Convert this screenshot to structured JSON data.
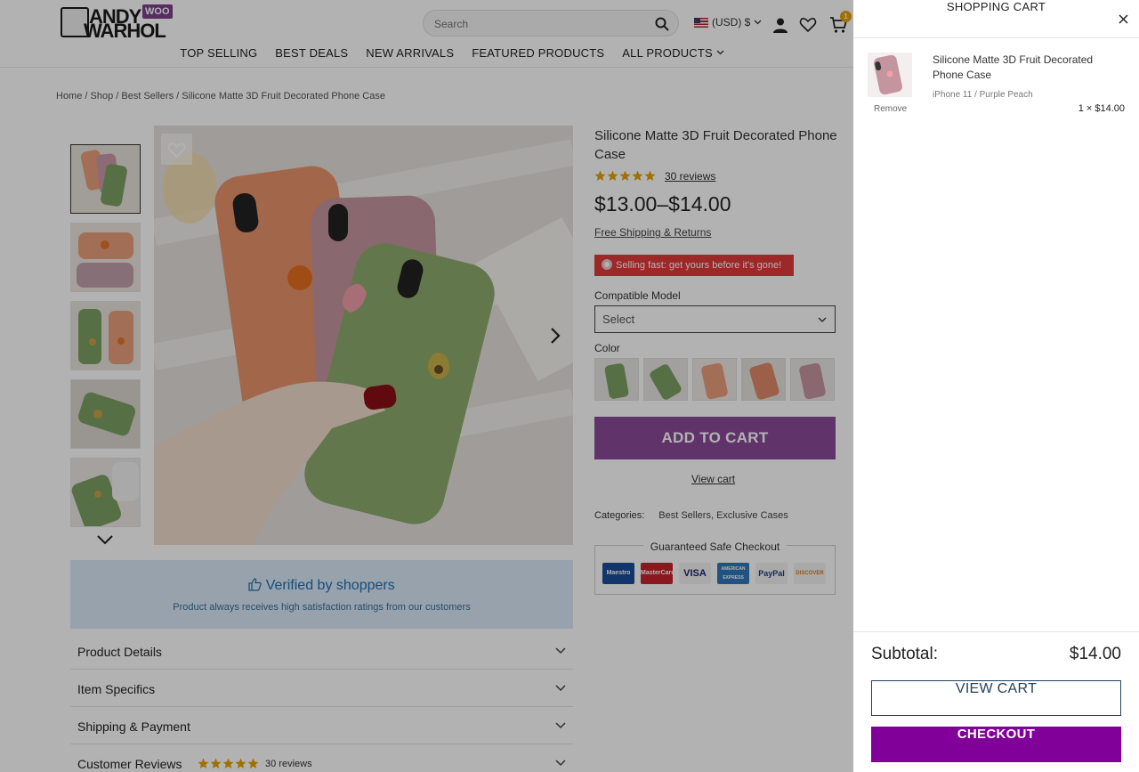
{
  "header": {
    "logo_line1": "ANDY",
    "logo_line2": "WARHOL",
    "logo_badge": "WOO",
    "search_placeholder": "Search",
    "currency": "(USD) $",
    "cart_count": "1"
  },
  "nav": {
    "items": [
      "TOP SELLING",
      "BEST DEALS",
      "NEW ARRIVALS",
      "FEATURED PRODUCTS",
      "ALL PRODUCTS"
    ]
  },
  "breadcrumb": {
    "home": "Home",
    "shop": "Shop",
    "category": "Best Sellers",
    "current": "Silicone Matte 3D Fruit Decorated Phone Case",
    "separator": " / "
  },
  "product": {
    "title": "Silicone Matte 3D Fruit Decorated Phone Case",
    "rating": 5,
    "reviews": "30 reviews",
    "price": "$13.00–$14.00",
    "shipping_link": "Free Shipping & Returns",
    "urgency": "Selling fast: get yours before it's gone!",
    "model_label": "Compatible Model",
    "model_select": "Select",
    "color_label": "Color",
    "add_to_cart": "ADD TO CART",
    "view_cart_link": "View cart",
    "categories_label": "Categories:",
    "categories_value": "Best Sellers, Exclusive Cases",
    "safe_checkout": "Guaranteed Safe Checkout",
    "payment_cards": [
      "Maestro",
      "MasterCard",
      "VISA",
      "AMERICAN EXPRESS",
      "PayPal",
      "DISCOVER"
    ]
  },
  "verified": {
    "title": "Verified by shoppers",
    "subtitle": "Product always receives high satisfaction ratings from our customers"
  },
  "accordion": {
    "items": [
      "Product Details",
      "Item Specifics",
      "Shipping & Payment",
      "Customer Reviews"
    ],
    "reviews_count": "30 reviews"
  },
  "cart": {
    "title": "SHOPPING CART",
    "item_name": "Silicone Matte 3D Fruit Decorated Phone Case",
    "item_variant": "iPhone 11 / Purple Peach",
    "item_qty_price": "1 × $14.00",
    "remove": "Remove",
    "subtotal_label": "Subtotal:",
    "subtotal_value": "$14.00",
    "view_cart": "VIEW CART",
    "checkout": "CHECKOUT"
  },
  "colors": {
    "accent_purple": "#800099",
    "add_to_cart_bg": "#8a4a99",
    "urgency_red": "#e03a3a",
    "star_gold": "#e6a100",
    "verified_bg": "#d8e8f6"
  }
}
